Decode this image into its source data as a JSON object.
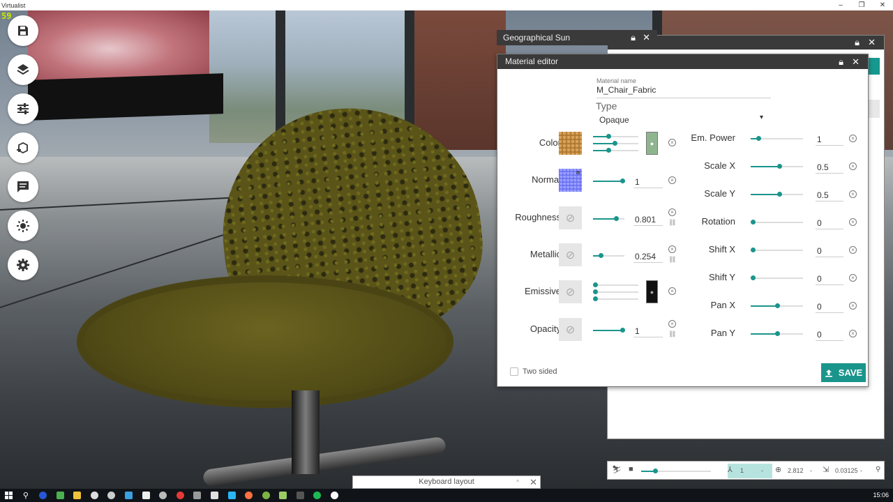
{
  "window": {
    "title": "Virtualist",
    "minimize": "–",
    "restore": "❐",
    "close": "✕"
  },
  "fps": "59",
  "toolbar": {
    "items": [
      "save-icon",
      "layers-icon",
      "sliders-icon",
      "add-object-icon",
      "comment-icon",
      "sun-icon",
      "settings-icon"
    ]
  },
  "geo_panel": {
    "title": "Geographical Sun"
  },
  "material_editor": {
    "title": "Material editor",
    "name_label": "Material name",
    "name_value": "M_Chair_Fabric",
    "type_label": "Type",
    "type_value": "Opaque",
    "left": [
      {
        "label": "Color",
        "value": ""
      },
      {
        "label": "Normal",
        "value": "1"
      },
      {
        "label": "Roughness",
        "value": "0.801"
      },
      {
        "label": "Metallic",
        "value": "0.254"
      },
      {
        "label": "Emissive",
        "value": ""
      },
      {
        "label": "Opacity",
        "value": "1"
      }
    ],
    "right": [
      {
        "label": "Em. Power",
        "value": "1",
        "level": 0.15
      },
      {
        "label": "Scale X",
        "value": "0.5",
        "level": 0.55
      },
      {
        "label": "Scale Y",
        "value": "0.5",
        "level": 0.55
      },
      {
        "label": "Rotation",
        "value": "0",
        "level": 0.0
      },
      {
        "label": "Shift X",
        "value": "0",
        "level": 0.0
      },
      {
        "label": "Shift Y",
        "value": "0",
        "level": 0.0
      },
      {
        "label": "Pan X",
        "value": "0",
        "level": 0.5
      },
      {
        "label": "Pan Y",
        "value": "0",
        "level": 0.5
      }
    ],
    "two_sided_label": "Two sided",
    "save_label": "SAVE"
  },
  "status_bar": {
    "field1": "1",
    "field2": "2.812",
    "field3": "0.03125",
    "sep": "-"
  },
  "keyboard_layout": {
    "label": "Keyboard layout",
    "up": "^",
    "close": "✕"
  },
  "taskbar": {
    "clock": "15:06"
  },
  "colors": {
    "accent": "#1a958c",
    "header": "#3a3a3a"
  }
}
